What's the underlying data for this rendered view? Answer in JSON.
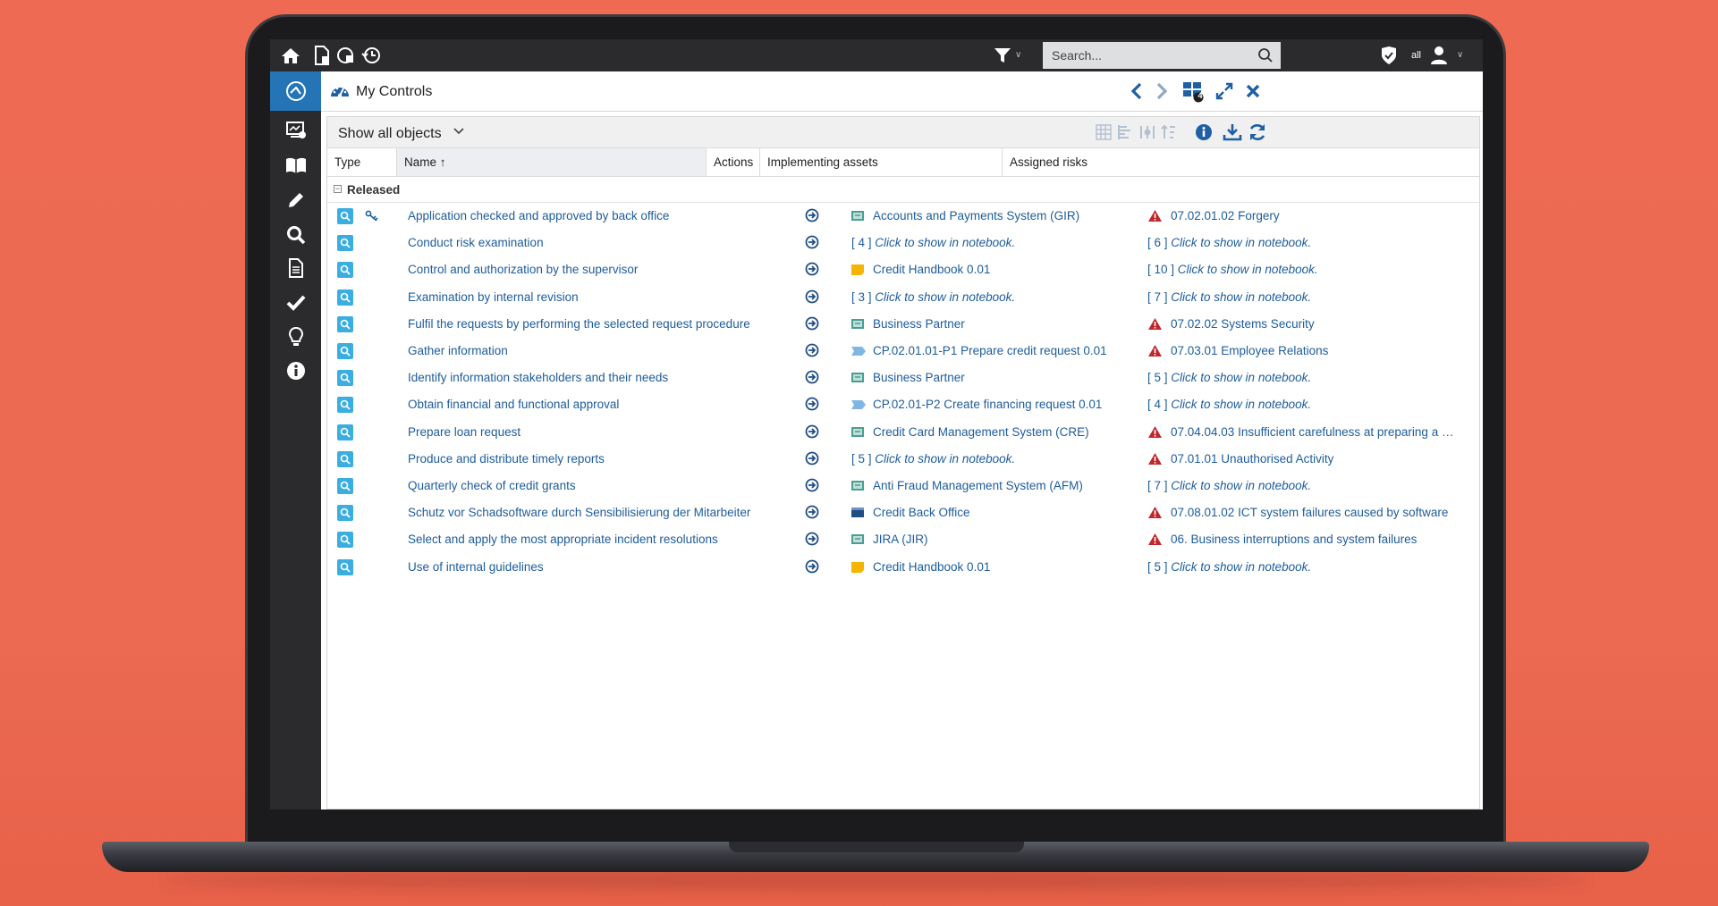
{
  "colors": {
    "accent": "#2474b6",
    "link": "#1d5c9a",
    "topbar": "#2b2b2d",
    "risk": "#c0272d",
    "control": "#3aaee0"
  },
  "topbar": {
    "search_placeholder": "Search...",
    "user_scope": "all"
  },
  "header": {
    "title": "My Controls",
    "badge": "4"
  },
  "filter": {
    "selected": "Show all objects"
  },
  "columns": {
    "type": "Type",
    "name": "Name ↑",
    "actions": "Actions",
    "assets": "Implementing assets",
    "risks": "Assigned risks"
  },
  "group": {
    "label": "Released"
  },
  "rows": [
    {
      "name": "Application checked and approved by back office",
      "asset_kind": "system",
      "asset": "Accounts and Payments System (GIR)",
      "risk_kind": "risk",
      "risk": "07.02.01.02 Forgery",
      "has_key": true
    },
    {
      "name": "Conduct risk examination",
      "asset_kind": "count",
      "asset_count": "[ 4 ]",
      "asset": "Click to show in notebook.",
      "risk_kind": "count",
      "risk_count": "[ 6 ]",
      "risk": "Click to show in notebook."
    },
    {
      "name": "Control and authorization by the supervisor",
      "asset_kind": "document",
      "asset": "Credit Handbook 0.01",
      "risk_kind": "count",
      "risk_count": "[ 10 ]",
      "risk": "Click to show in notebook."
    },
    {
      "name": "Examination by internal revision",
      "asset_kind": "count",
      "asset_count": "[ 3 ]",
      "asset": "Click to show in notebook.",
      "risk_kind": "count",
      "risk_count": "[ 7 ]",
      "risk": "Click to show in notebook."
    },
    {
      "name": "Fulfil the requests by performing the selected request procedure",
      "asset_kind": "system",
      "asset": "Business Partner",
      "risk_kind": "risk",
      "risk": "07.02.02 Systems Security"
    },
    {
      "name": "Gather information",
      "asset_kind": "process",
      "asset": "CP.02.01.01-P1 Prepare credit request 0.01",
      "risk_kind": "risk",
      "risk": "07.03.01 Employee Relations"
    },
    {
      "name": "Identify information stakeholders and their needs",
      "asset_kind": "system",
      "asset": "Business Partner",
      "risk_kind": "count",
      "risk_count": "[ 5 ]",
      "risk": "Click to show in notebook."
    },
    {
      "name": "Obtain financial and functional approval",
      "asset_kind": "process",
      "asset": "CP.02.01-P2 Create financing request 0.01",
      "risk_kind": "count",
      "risk_count": "[ 4 ]",
      "risk": "Click to show in notebook."
    },
    {
      "name": "Prepare loan request",
      "asset_kind": "system",
      "asset": "Credit Card Management System (CRE)",
      "risk_kind": "risk",
      "risk": "07.04.04.03 Insufficient carefulness at preparing a …"
    },
    {
      "name": "Produce and distribute timely reports",
      "asset_kind": "count",
      "asset_count": "[ 5 ]",
      "asset": "Click to show in notebook.",
      "risk_kind": "risk",
      "risk": "07.01.01 Unauthorised Activity"
    },
    {
      "name": "Quarterly check of credit grants",
      "asset_kind": "system",
      "asset": "Anti Fraud Management System (AFM)",
      "risk_kind": "count",
      "risk_count": "[ 7 ]",
      "risk": "Click to show in notebook."
    },
    {
      "name": "Schutz vor Schadsoftware durch Sensibilisierung der Mitarbeiter",
      "asset_kind": "unit",
      "asset": "Credit Back Office",
      "risk_kind": "risk",
      "risk": "07.08.01.02 ICT system failures caused by software"
    },
    {
      "name": "Select and apply the most appropriate incident resolutions",
      "asset_kind": "system",
      "asset": "JIRA (JIR)",
      "risk_kind": "risk",
      "risk": "06. Business interruptions and system failures"
    },
    {
      "name": "Use of internal guidelines",
      "asset_kind": "document",
      "asset": "Credit Handbook 0.01",
      "risk_kind": "count",
      "risk_count": "[ 5 ]",
      "risk": "Click to show in notebook."
    }
  ]
}
